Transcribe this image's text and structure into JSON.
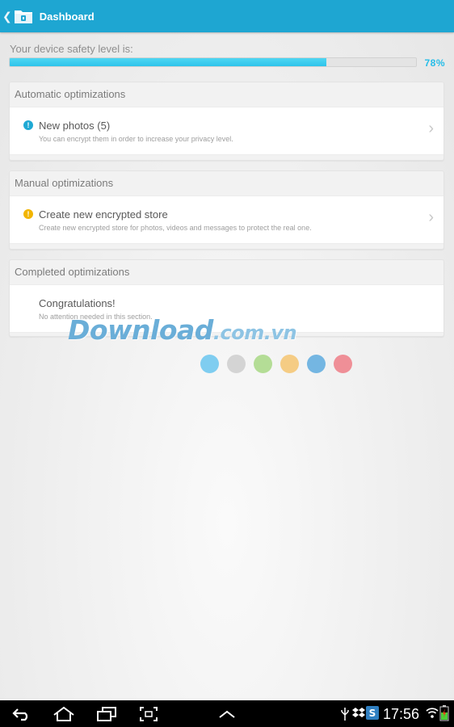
{
  "action_bar": {
    "title": "Dashboard",
    "color": "#1ea6d2",
    "back_icon": "chevron-left-icon",
    "app_icon": "folder-lock-icon"
  },
  "safety": {
    "label": "Your device safety level is:",
    "percent_text": "78%",
    "level": 0.78,
    "color": "#2ec4eb"
  },
  "sections": [
    {
      "header": "Automatic optimizations",
      "items": [
        {
          "title": "New photos (5)",
          "subtitle": "You can encrypt them in order to increase your privacy level.",
          "icon": "info-icon",
          "icon_color": "#1fa9d4",
          "has_chevron": true
        }
      ]
    },
    {
      "header": "Manual optimizations",
      "items": [
        {
          "title": "Create new encrypted store",
          "subtitle": "Create new encrypted store for photos, videos and messages to protect the real one.",
          "icon": "warning-icon",
          "icon_color": "#f2b500",
          "has_chevron": true
        }
      ]
    },
    {
      "header": "Completed optimizations",
      "items": [
        {
          "title": "Congratulations!",
          "subtitle": "No attention needed in this section.",
          "icon": "",
          "has_chevron": false
        }
      ]
    }
  ],
  "watermark": {
    "text_main": "Download",
    "text_suffix": ".com.vn",
    "dot_colors": [
      "#7fcdf0",
      "#d4d4d4",
      "#b4dd96",
      "#f5cc84",
      "#74b6e2",
      "#ef8f97"
    ]
  },
  "nav_bar": {
    "time": "17:56",
    "buttons": [
      "back-icon",
      "home-icon",
      "recent-apps-icon",
      "screenshot-icon",
      "chevron-up-icon"
    ],
    "status_icons": [
      "usb-icon",
      "dropbox-icon",
      "shield-app-icon",
      "wifi-icon",
      "battery-icon"
    ]
  }
}
